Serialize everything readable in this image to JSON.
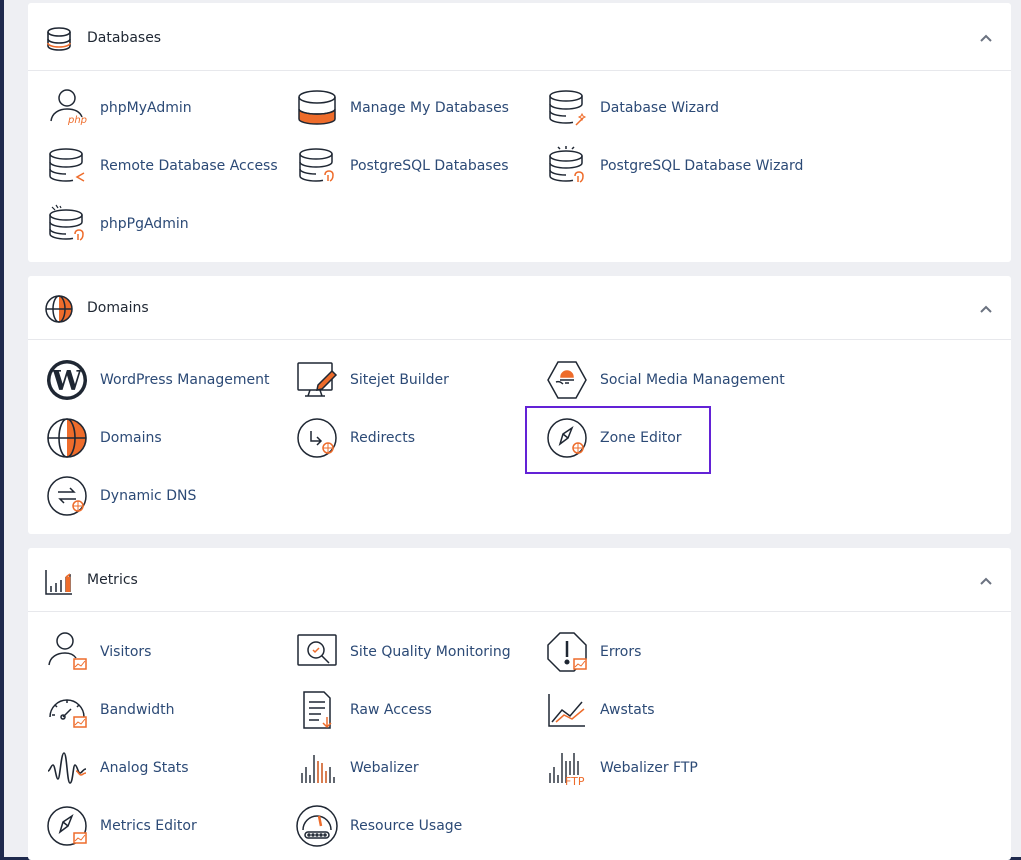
{
  "panels": {
    "databases": {
      "title": "Databases",
      "items": [
        "phpMyAdmin",
        "Manage My Databases",
        "Database Wizard",
        "Remote Database Access",
        "PostgreSQL Databases",
        "PostgreSQL Database Wizard",
        "phpPgAdmin"
      ],
      "php_badge": "php"
    },
    "domains": {
      "title": "Domains",
      "items": [
        "WordPress Management",
        "Sitejet Builder",
        "Social Media Management",
        "Domains",
        "Redirects",
        "Zone Editor",
        "Dynamic DNS"
      ],
      "wp_letter": "W"
    },
    "metrics": {
      "title": "Metrics",
      "items": [
        "Visitors",
        "Site Quality Monitoring",
        "Errors",
        "Bandwidth",
        "Raw Access",
        "Awstats",
        "Analog Stats",
        "Webalizer",
        "Webalizer FTP",
        "Metrics Editor",
        "Resource Usage"
      ],
      "ftp_badge": "FTP"
    }
  },
  "colors": {
    "accent": "#ee6c2b",
    "highlight": "#6322d6",
    "link": "#2c4a76",
    "sidebar": "#1f2a4d"
  }
}
